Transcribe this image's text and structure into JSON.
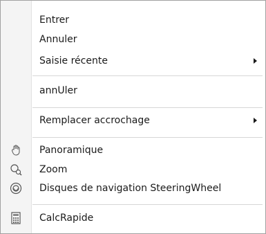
{
  "menu": {
    "items": [
      {
        "label": "Entrer"
      },
      {
        "label": "Annuler"
      },
      {
        "label": "Saisie récente"
      },
      {
        "label": "annUler"
      },
      {
        "label": "Remplacer accrochage"
      },
      {
        "label": "Panoramique",
        "icon": "pan-hand-icon"
      },
      {
        "label": "Zoom",
        "icon": "zoom-magnifier-icon"
      },
      {
        "label": "Disques de navigation SteeringWheel",
        "icon": "steering-wheel-icon"
      },
      {
        "label": "CalcRapide",
        "icon": "calculator-icon"
      }
    ]
  }
}
